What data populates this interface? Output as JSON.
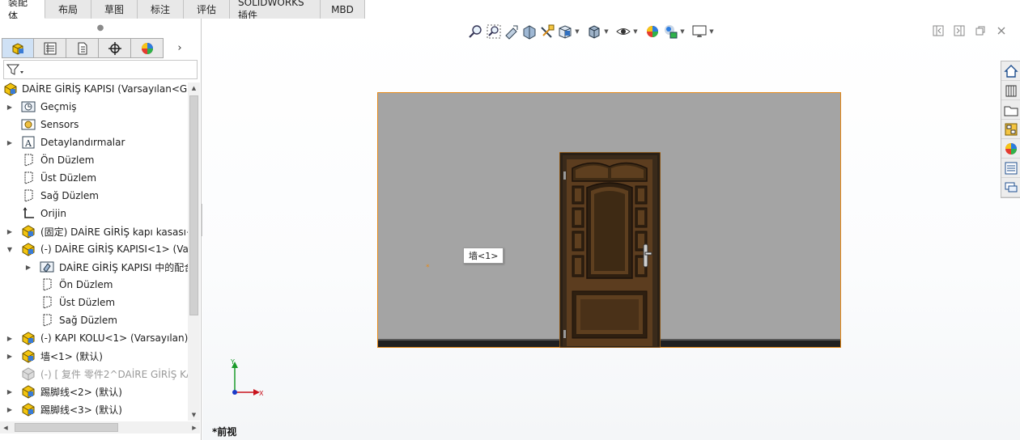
{
  "tabs": [
    "装配体",
    "布局",
    "草图",
    "标注",
    "评估",
    "SOLIDWORKS 插件",
    "MBD"
  ],
  "tree": {
    "root": "DAİRE GİRİŞ KAPISI  (Varsayılan<G",
    "items": [
      {
        "label": "Geçmiş",
        "icon": "history-icon",
        "arrow": "▶",
        "indent": 0
      },
      {
        "label": "Sensors",
        "icon": "sensor-icon",
        "arrow": "",
        "indent": 0
      },
      {
        "label": "Detaylandırmalar",
        "icon": "annotations-icon",
        "arrow": "▶",
        "indent": 0
      },
      {
        "label": "Ön Düzlem",
        "icon": "plane-icon",
        "arrow": "",
        "indent": 0
      },
      {
        "label": "Üst Düzlem",
        "icon": "plane-icon",
        "arrow": "",
        "indent": 0
      },
      {
        "label": "Sağ Düzlem",
        "icon": "plane-icon",
        "arrow": "",
        "indent": 0
      },
      {
        "label": "Orijin",
        "icon": "origin-icon",
        "arrow": "",
        "indent": 0
      },
      {
        "label": "(固定) DAİRE GİRİŞ kapı kasası<",
        "icon": "component-icon",
        "arrow": "▶",
        "indent": 0
      },
      {
        "label": "(-) DAİRE GİRİŞ KAPISI<1> (Var",
        "icon": "component-icon",
        "arrow": "▼",
        "indent": 0
      },
      {
        "label": "DAİRE GİRİŞ KAPISI 中的配合",
        "icon": "mates-icon",
        "arrow": "▶",
        "indent": 1
      },
      {
        "label": "Ön Düzlem",
        "icon": "plane-icon",
        "arrow": "",
        "indent": 1
      },
      {
        "label": "Üst Düzlem",
        "icon": "plane-icon",
        "arrow": "",
        "indent": 1
      },
      {
        "label": "Sağ Düzlem",
        "icon": "plane-icon",
        "arrow": "",
        "indent": 1
      },
      {
        "label": "(-) KAPI KOLU<1> (Varsayılan)",
        "icon": "component-icon",
        "arrow": "▶",
        "indent": 0
      },
      {
        "label": "墙<1> (默认)",
        "icon": "component-icon",
        "arrow": "▶",
        "indent": 0
      },
      {
        "label": "(-) [ 复件 零件2^DAİRE GİRİŞ KA",
        "icon": "suppressed-component-icon",
        "arrow": "",
        "indent": 0,
        "dim": true
      },
      {
        "label": "踢脚线<2> (默认)",
        "icon": "component-icon",
        "arrow": "▶",
        "indent": 0
      },
      {
        "label": "踢脚线<3> (默认)",
        "icon": "component-icon",
        "arrow": "▶",
        "indent": 0
      }
    ]
  },
  "tooltip": "墙<1>",
  "view_name": "*前视",
  "triad": {
    "x": "X",
    "y": "Y"
  }
}
